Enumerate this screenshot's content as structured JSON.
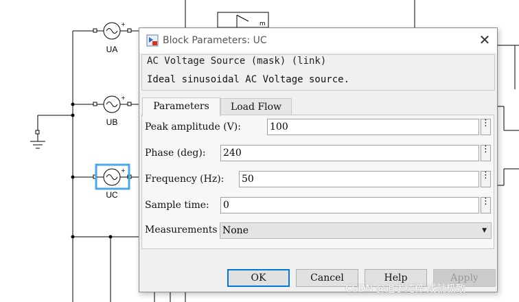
{
  "diagram": {
    "blocks": [
      {
        "label": "UA",
        "selected": false
      },
      {
        "label": "UB",
        "selected": false
      },
      {
        "label": "UC",
        "selected": true
      }
    ],
    "partial_block_text": "m",
    "selection_color": "#4aa8e8"
  },
  "dialog": {
    "title": "Block Parameters: UC",
    "title_icon": "simulink-block-icon",
    "close_glyph": "✕",
    "mask_title": "AC Voltage Source (mask) (link)",
    "mask_description": "Ideal sinusoidal AC Voltage source.",
    "tabs": [
      {
        "label": "Parameters",
        "active": true
      },
      {
        "label": "Load Flow",
        "active": false
      }
    ],
    "params": {
      "peak_amplitude": {
        "label": "Peak amplitude (V):",
        "value": "100"
      },
      "phase": {
        "label": "Phase (deg):",
        "value": "240"
      },
      "frequency": {
        "label": "Frequency (Hz):",
        "value": "50"
      },
      "sample_time": {
        "label": "Sample time:",
        "value": "0"
      },
      "measurements": {
        "label": "Measurements",
        "selected": "None"
      }
    },
    "more_options_glyph": "⋮",
    "buttons": {
      "ok": "OK",
      "cancel": "Cancel",
      "help": "Help",
      "apply": "Apply"
    },
    "accent_color": "#0078d7"
  },
  "watermark": "CSDN @追求纯粹 成就极致"
}
